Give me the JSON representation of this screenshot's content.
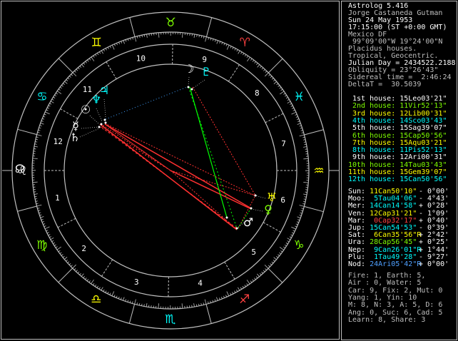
{
  "header": {
    "program": "Astrolog 5.416",
    "name": "Jorge Castaneda Gutman",
    "date": "Sun 24 May 1953",
    "time": "17:15:00 (ST +0:00 GMT)",
    "place": "Mexico DF",
    "coords": " 99°09'00\"W 19°24'00\"N",
    "houses": "Placidus houses.",
    "zodiac": "Tropical, Geocentric.",
    "julian": "Julian Day = 2434522.2188",
    "obliquity": "Obliquity = 23°26'43\"",
    "sidereal": "Sidereal time =  2:46:24",
    "deltat": "DeltaT =  30.5039"
  },
  "houses": [
    {
      "text": "1st house: 15Leo03'21\"",
      "color": "#ffffff"
    },
    {
      "text": "2nd house: 11Vir52'13\"",
      "color": "#7fff00"
    },
    {
      "text": "3rd house: 12Lib00'31\"",
      "color": "#ffff00"
    },
    {
      "text": "4th house: 14Sco03'43\"",
      "color": "#00ffff"
    },
    {
      "text": "5th house: 15Sag39'07\"",
      "color": "#ffffff"
    },
    {
      "text": "6th house: 15Cap50'56\"",
      "color": "#7fff00"
    },
    {
      "text": "7th house: 15Aqu03'21\"",
      "color": "#ffff00"
    },
    {
      "text": "8th house: 11Pis52'13\"",
      "color": "#00ffff"
    },
    {
      "text": "9th house: 12Ari00'31\"",
      "color": "#ffffff"
    },
    {
      "text": "10th house: 14Tau03'43\"",
      "color": "#7fff00"
    },
    {
      "text": "11th house: 15Gem39'07\"",
      "color": "#ffff00"
    },
    {
      "text": "12th house: 15Can50'56\"",
      "color": "#00ffff"
    }
  ],
  "planets": [
    {
      "label": "Sun:",
      "pos": "11Can50'10\"",
      "speed": "- 0°00'",
      "color": "#ffff00"
    },
    {
      "label": "Moo:",
      "pos": " 5Tau04'06\"",
      "speed": "- 4°43'",
      "color": "#00ffff"
    },
    {
      "label": "Mer:",
      "pos": "14Can14'58\"",
      "speed": "+ 0°28'",
      "color": "#00ffff"
    },
    {
      "label": "Ven:",
      "pos": "12Cap31'21\"",
      "speed": "- 1°09'",
      "color": "#ffff00"
    },
    {
      "label": "Mar:",
      "pos": " 0Cap32'17\"",
      "speed": "+ 0°40'",
      "color": "#ff4040"
    },
    {
      "label": "Jup:",
      "pos": "15Can54'53\"",
      "speed": "- 0°39'",
      "color": "#00ffff"
    },
    {
      "label": "Sat:",
      "pos": " 6Can35'56\"R",
      "speed": "+ 2°42'",
      "color": "#ffff00"
    },
    {
      "label": "Ura:",
      "pos": "28Cap56'45\"",
      "speed": "+ 0°25'",
      "color": "#7fff00"
    },
    {
      "label": "Nep:",
      "pos": " 9Can26'01\"R",
      "speed": "+ 1°44'",
      "color": "#00ffff"
    },
    {
      "label": "Plu:",
      "pos": " 1Tau49'28\"",
      "speed": "- 9°27'",
      "color": "#00ffff"
    },
    {
      "label": "Nod:",
      "pos": "24Ari05'42\"R",
      "speed": "+ 0°00'",
      "color": "#4fa0ff"
    }
  ],
  "summary": [
    "Fire: 1, Earth: 5,",
    "Air : 0, Water: 5",
    "Car: 9, Fix: 2, Mut: 0",
    "Yang: 1, Yin: 10",
    "M: 8, N: 3, A: 5, D: 6",
    "Ang: 0, Suc: 6, Cad: 5",
    "Learn: 8, Share: 3"
  ],
  "wheel": {
    "house_numbers": [
      "1",
      "2",
      "3",
      "4",
      "5",
      "6",
      "7",
      "8",
      "9",
      "10",
      "11",
      "12"
    ],
    "signs": [
      {
        "name": "aries-icon",
        "glyph": "♈",
        "color": "#ff4040"
      },
      {
        "name": "taurus-icon",
        "glyph": "♉",
        "color": "#7fff00"
      },
      {
        "name": "gemini-icon",
        "glyph": "♊",
        "color": "#ffff00"
      },
      {
        "name": "cancer-icon",
        "glyph": "♋",
        "color": "#00ffff"
      },
      {
        "name": "leo-icon",
        "glyph": "♌",
        "color": "#ffffff"
      },
      {
        "name": "virgo-icon",
        "glyph": "♍",
        "color": "#7fff00"
      },
      {
        "name": "libra-icon",
        "glyph": "♎",
        "color": "#ffff00"
      },
      {
        "name": "scorpio-icon",
        "glyph": "♏",
        "color": "#00ffff"
      },
      {
        "name": "sagittarius-icon",
        "glyph": "♐",
        "color": "#ff4040"
      },
      {
        "name": "capricorn-icon",
        "glyph": "♑",
        "color": "#7fff00"
      },
      {
        "name": "aquarius-icon",
        "glyph": "♒",
        "color": "#ffff00"
      },
      {
        "name": "pisces-icon",
        "glyph": "♓",
        "color": "#00ffff"
      }
    ],
    "planet_glyphs": [
      {
        "name": "moon-icon",
        "glyph": "☽",
        "color": "#ffffff"
      },
      {
        "name": "pluto-icon",
        "glyph": "♇",
        "color": "#00ffff"
      },
      {
        "name": "jupiter-icon",
        "glyph": "♃",
        "color": "#00ffff"
      },
      {
        "name": "neptune-icon",
        "glyph": "♆",
        "color": "#00ffff"
      },
      {
        "name": "sun-icon",
        "glyph": "☉",
        "color": "#ffffff"
      },
      {
        "name": "mercury-icon",
        "glyph": "☿",
        "color": "#ffffff"
      },
      {
        "name": "saturn-icon",
        "glyph": "♄",
        "color": "#ffffff"
      },
      {
        "name": "uranus-icon",
        "glyph": "♅",
        "color": "#ffff00"
      },
      {
        "name": "venus-icon",
        "glyph": "♀",
        "color": "#7fff00"
      },
      {
        "name": "mars-icon",
        "glyph": "♂",
        "color": "#ffffff"
      },
      {
        "name": "node-icon",
        "glyph": "☊",
        "color": "#ffffff"
      }
    ]
  }
}
